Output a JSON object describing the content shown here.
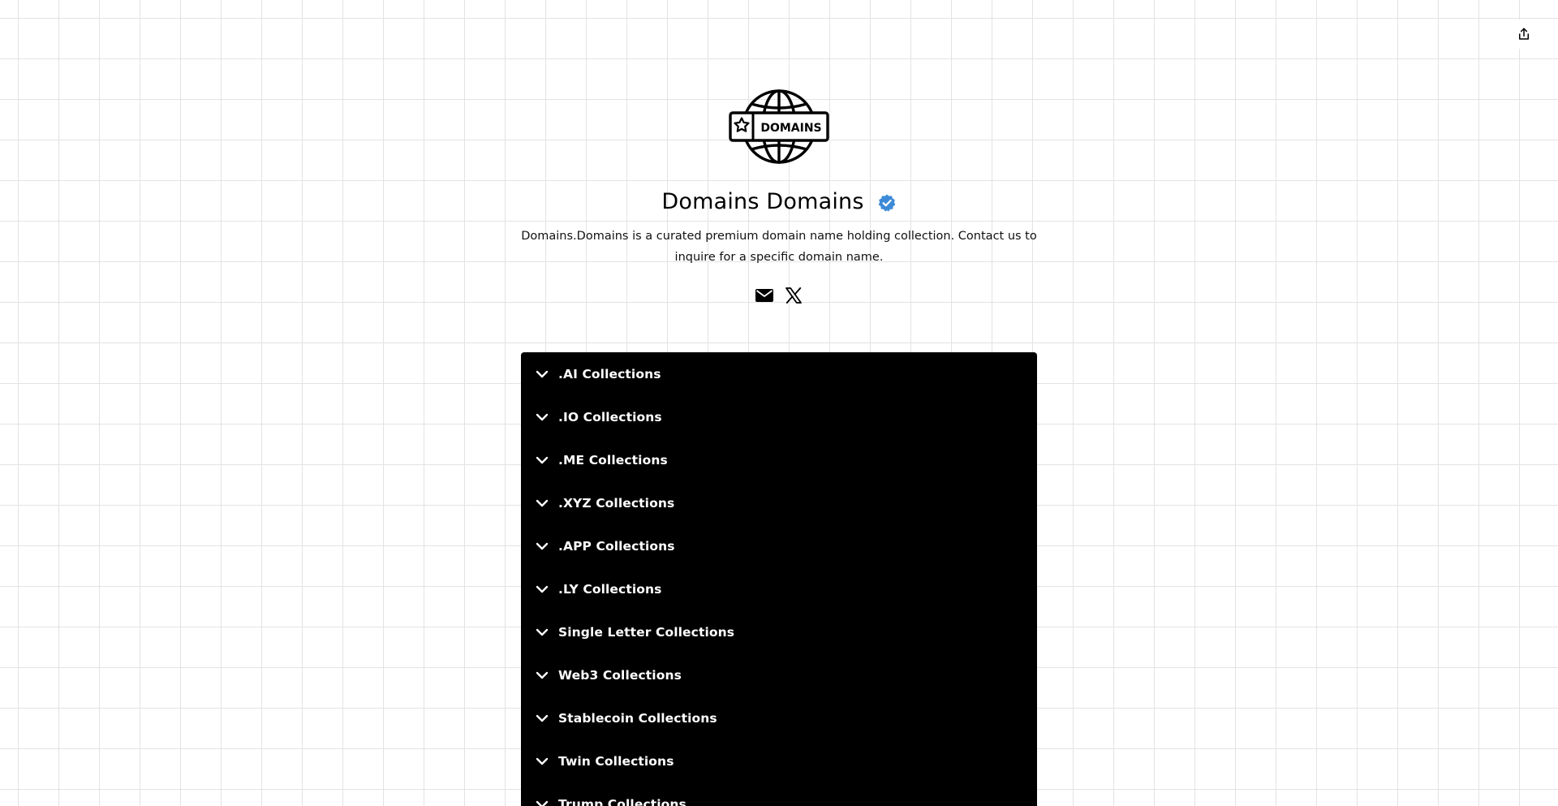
{
  "profile": {
    "logo_text": "DOMAINS",
    "title": "Domains Domains",
    "description": "Domains.Domains is a curated premium domain name holding collection. Contact us to inquire for a specific domain name."
  },
  "icons": {
    "share": "share-icon",
    "verified": "verified-badge-icon",
    "email": "email-icon",
    "x": "x-icon",
    "chevron": "chevron-down-icon"
  },
  "colors": {
    "panel_background": "#000000",
    "panel_text": "#ffffff",
    "verified_badge": "#3d8bd8",
    "page_background": "#ffffff",
    "grid_line": "#e3e3e3"
  },
  "collections": [
    {
      "label": ".AI Collections"
    },
    {
      "label": ".IO Collections"
    },
    {
      "label": ".ME Collections"
    },
    {
      "label": ".XYZ Collections"
    },
    {
      "label": ".APP Collections"
    },
    {
      "label": ".LY Collections"
    },
    {
      "label": "Single Letter Collections"
    },
    {
      "label": "Web3 Collections"
    },
    {
      "label": "Stablecoin Collections"
    },
    {
      "label": "Twin Collections"
    },
    {
      "label": "Trump Collections"
    }
  ]
}
